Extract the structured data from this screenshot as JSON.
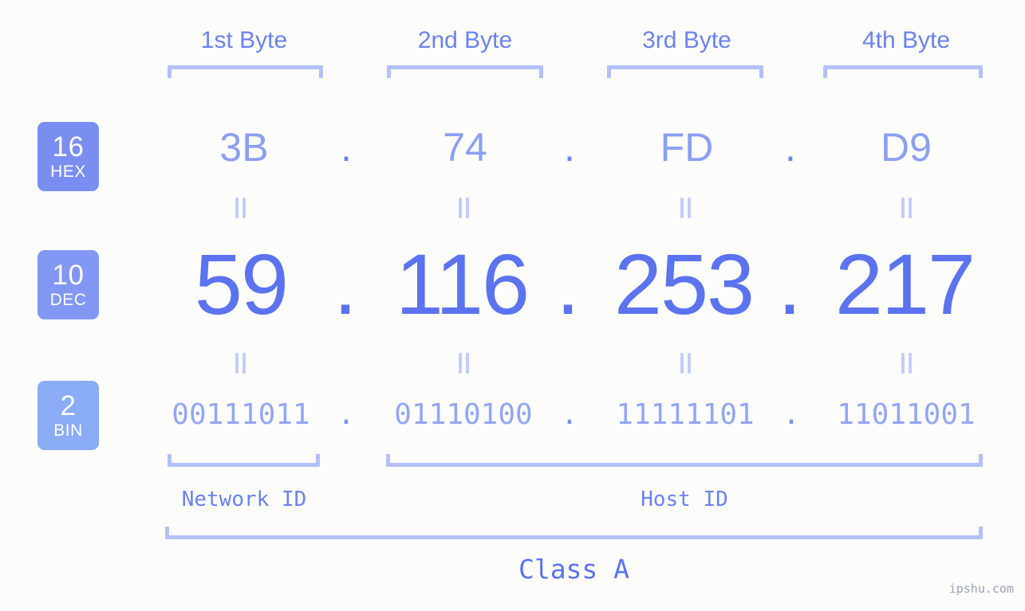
{
  "bytes": {
    "headers": [
      "1st Byte",
      "2nd Byte",
      "3rd Byte",
      "4th Byte"
    ]
  },
  "bases": [
    {
      "num": "16",
      "name": "HEX",
      "color": "#7a8ef2"
    },
    {
      "num": "10",
      "name": "DEC",
      "color": "#8297f4"
    },
    {
      "num": "2",
      "name": "BIN",
      "color": "#8aabf5"
    }
  ],
  "rows": {
    "hex": {
      "values": [
        "3B",
        "74",
        "FD",
        "D9"
      ],
      "separator": "."
    },
    "dec": {
      "values": [
        "59",
        "116",
        "253",
        "217"
      ],
      "separator": "."
    },
    "bin": {
      "values": [
        "00111011",
        "01110100",
        "11111101",
        "11011001"
      ],
      "separator": "."
    }
  },
  "regions": {
    "network_id": "Network ID",
    "host_id": "Host ID",
    "class": "Class A"
  },
  "watermark": "ipshu.com"
}
